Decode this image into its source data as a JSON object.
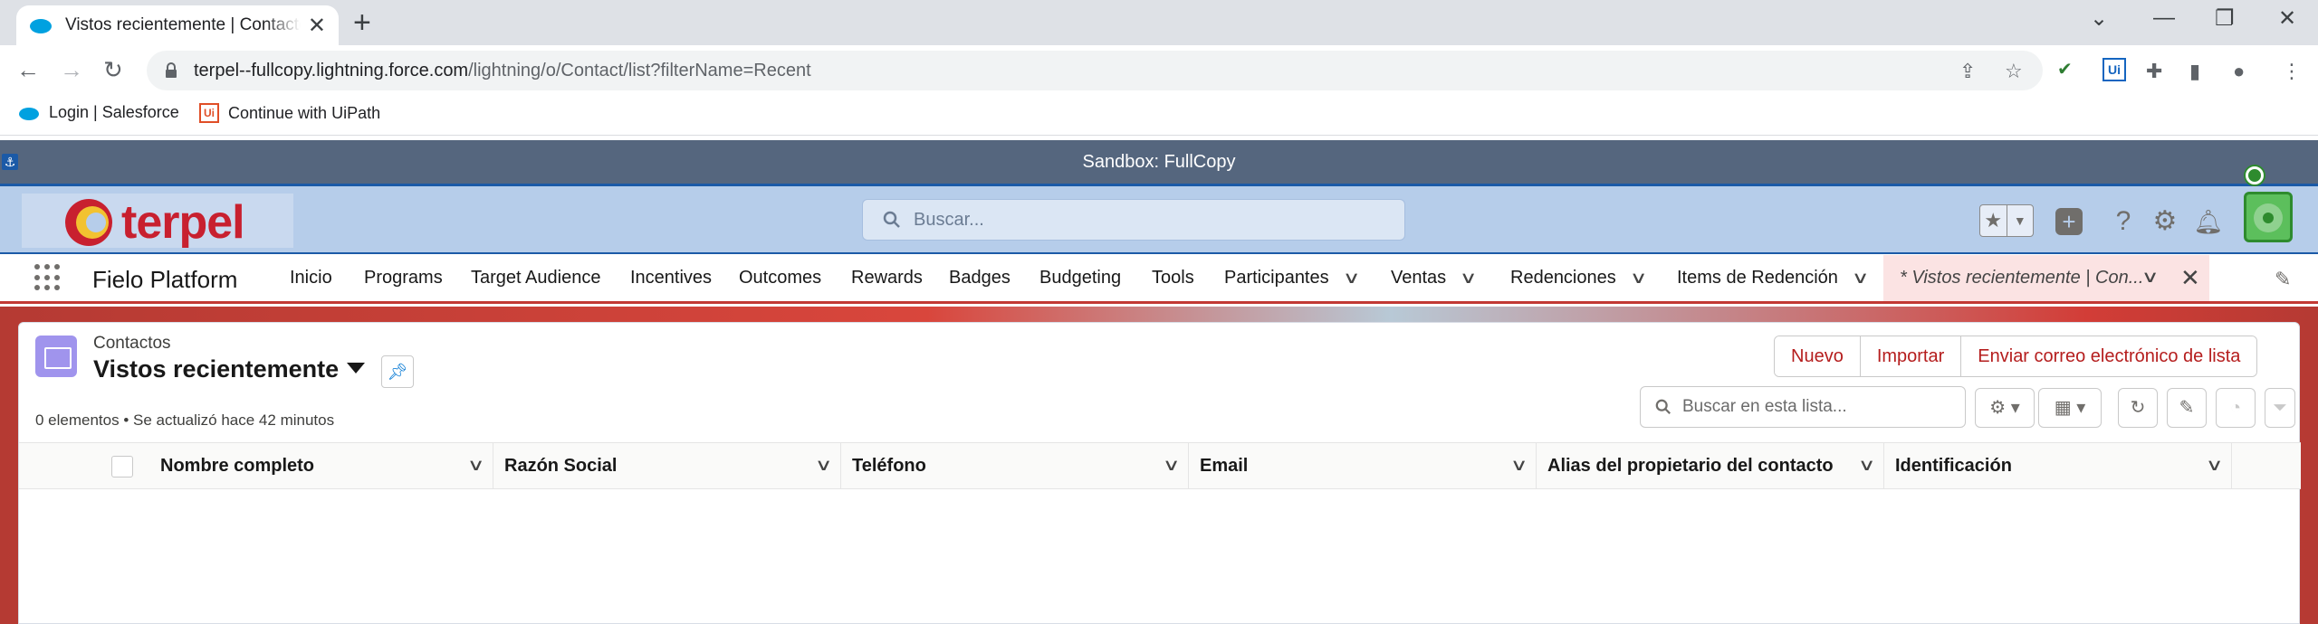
{
  "browser": {
    "tab_title": "Vistos recientemente | Contactos | Salesforce",
    "url_host": "terpel--fullcopy.lightning.force.com",
    "url_path": "/lightning/o/Contact/list?filterName=Recent",
    "bookmarks": [
      "Login | Salesforce",
      "Continue with UiPath"
    ]
  },
  "sandbox_banner": "Sandbox: FullCopy",
  "header": {
    "logo_text": "terpel",
    "search_placeholder": "Buscar..."
  },
  "appnav": {
    "app_name": "Fielo Platform",
    "items": [
      "Inicio",
      "Programs",
      "Target Audience",
      "Incentives",
      "Outcomes",
      "Rewards",
      "Badges",
      "Budgeting",
      "Tools",
      "Participantes",
      "Ventas",
      "Redenciones",
      "Items de Redención"
    ],
    "active_tab": "* Vistos recientemente | Con..."
  },
  "list": {
    "object_label": "Contactos",
    "title": "Vistos recientemente",
    "meta": "0 elementos • Se actualizó hace 42 minutos",
    "buttons": [
      "Nuevo",
      "Importar",
      "Enviar correo electrónico de lista"
    ],
    "search_placeholder": "Buscar en esta lista...",
    "columns": [
      "Nombre completo",
      "Razón Social",
      "Teléfono",
      "Email",
      "Alias del propietario del contacto",
      "Identificación"
    ]
  },
  "colors": {
    "sandbox_bg": "#55667e",
    "header_bg": "#b6cdea",
    "brand_red": "#c8202f",
    "button_text": "#b51d1d",
    "object_icon": "#a094ed"
  }
}
